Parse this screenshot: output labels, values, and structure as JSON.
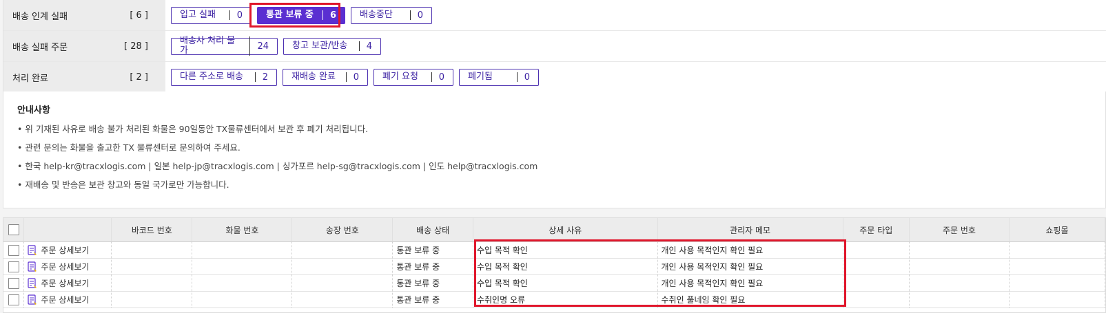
{
  "filters": [
    {
      "name": "배송 인계 실패",
      "count": "[ 6 ]",
      "buttons": [
        {
          "label": "입고 실패",
          "count": "0",
          "active": false
        },
        {
          "label": "통관 보류 중",
          "count": "6",
          "active": true
        },
        {
          "label": "배송중단",
          "count": "0",
          "active": false
        }
      ]
    },
    {
      "name": "배송 실패 주문",
      "count": "[ 28 ]",
      "buttons": [
        {
          "label": "배송사 처리 불가",
          "count": "24",
          "active": false
        },
        {
          "label": "창고 보관/반송",
          "count": "4",
          "active": false
        }
      ]
    },
    {
      "name": "처리 완료",
      "count": "[ 2 ]",
      "buttons": [
        {
          "label": "다른 주소로 배송",
          "count": "2",
          "active": false
        },
        {
          "label": "재배송 완료",
          "count": "0",
          "active": false
        },
        {
          "label": "폐기 요청",
          "count": "0",
          "active": false
        },
        {
          "label": "폐기됨",
          "count": "0",
          "active": false
        }
      ]
    }
  ],
  "notice": {
    "title": "안내사항",
    "lines": [
      "• 위 기재된 사유로 배송 불가 처리된 화물은 90일동안 TX물류센터에서 보관 후 폐기 처리됩니다.",
      "• 관련 문의는 화물을 출고한 TX 물류센터로 문의하여 주세요.",
      "• 한국 help-kr@tracxlogis.com | 일본 help-jp@tracxlogis.com | 싱가포르 help-sg@tracxlogis.com | 인도 help@tracxlogis.com",
      "• 재배송 및 반송은 보관 창고와 동일 국가로만 가능합니다."
    ]
  },
  "table": {
    "columns": [
      "",
      "",
      "바코드 번호",
      "화물 번호",
      "송장 번호",
      "배송 상태",
      "상세 사유",
      "관리자 메모",
      "주문 타입",
      "주문 번호",
      "쇼핑몰"
    ],
    "detail_label": "주문 상세보기",
    "rows": [
      {
        "status": "통관 보류 중",
        "reason": "수입 목적 확인",
        "memo": "개인 사용 목적인지 확인 필요"
      },
      {
        "status": "통관 보류 중",
        "reason": "수입 목적 확인",
        "memo": "개인 사용 목적인지 확인 필요"
      },
      {
        "status": "통관 보류 중",
        "reason": "수입 목적 확인",
        "memo": "개인 사용 목적인지 확인 필요"
      },
      {
        "status": "통관 보류 중",
        "reason": "수취인명 오류",
        "memo": "수취인 풀네임 확인 필요"
      }
    ]
  },
  "colors": {
    "accent": "#5a2fd1",
    "highlight": "#e0162b"
  }
}
